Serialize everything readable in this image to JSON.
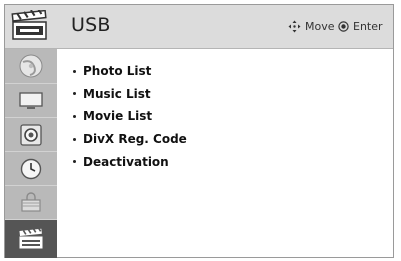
{
  "header": {
    "title": "USB",
    "icon": "clapperboard-icon",
    "hints": [
      {
        "icon": "four-way-arrow-icon",
        "label": "Move"
      },
      {
        "icon": "ok-button-icon",
        "label": "Enter"
      }
    ]
  },
  "sidebar": {
    "items": [
      {
        "icon": "disc-icon",
        "active": false
      },
      {
        "icon": "tv-icon",
        "active": false
      },
      {
        "icon": "speaker-icon",
        "active": false
      },
      {
        "icon": "clock-icon",
        "active": false
      },
      {
        "icon": "lock-icon",
        "active": false
      },
      {
        "icon": "clapperboard-icon",
        "active": true
      }
    ]
  },
  "menu": {
    "items": [
      {
        "label": "Photo List"
      },
      {
        "label": "Music List"
      },
      {
        "label": "Movie List"
      },
      {
        "label": "DivX Reg. Code"
      },
      {
        "label": "Deactivation"
      }
    ]
  },
  "colors": {
    "header_bg": "#dcdcdc",
    "sidebar_bg": "#b9b9b9",
    "sidebar_active_bg": "#555555",
    "text": "#111111"
  }
}
